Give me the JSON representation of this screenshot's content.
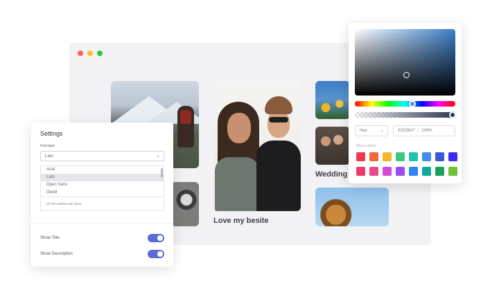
{
  "browser": {
    "dots": [
      "#ff5f57",
      "#febc2e",
      "#28c840"
    ]
  },
  "gallery": {
    "main_caption": "Love my besite",
    "wedding_caption": "Wedding"
  },
  "settings": {
    "title": "Settings",
    "font_label": "Font type",
    "font_value": "Lato",
    "font_options": [
      "Arial",
      "Lato",
      "Open Sans",
      "David"
    ],
    "selected_option": "Lato",
    "textarea_text": "Ut non varius nisi urna.",
    "show_title_label": "Show Title",
    "show_title_on": true,
    "show_description_label": "Show Description",
    "show_description_on": true,
    "accent": "#5b6cd6"
  },
  "color_picker": {
    "mode": "Hex",
    "hex_value": "#322BA7",
    "alpha_value": "100%",
    "more_colors_label": "More colors",
    "swatches_row1": [
      "#f0394f",
      "#f0693a",
      "#f7b52a",
      "#3cc77a",
      "#1fc4b0",
      "#3f8ff0",
      "#3a5bd9",
      "#3b2cf0"
    ],
    "swatches_row2": [
      "#ee3b6a",
      "#e64c8c",
      "#d24ad6",
      "#9b4df0",
      "#2f86f0",
      "#13a89e",
      "#1e9e5c",
      "#6fc23a"
    ]
  }
}
